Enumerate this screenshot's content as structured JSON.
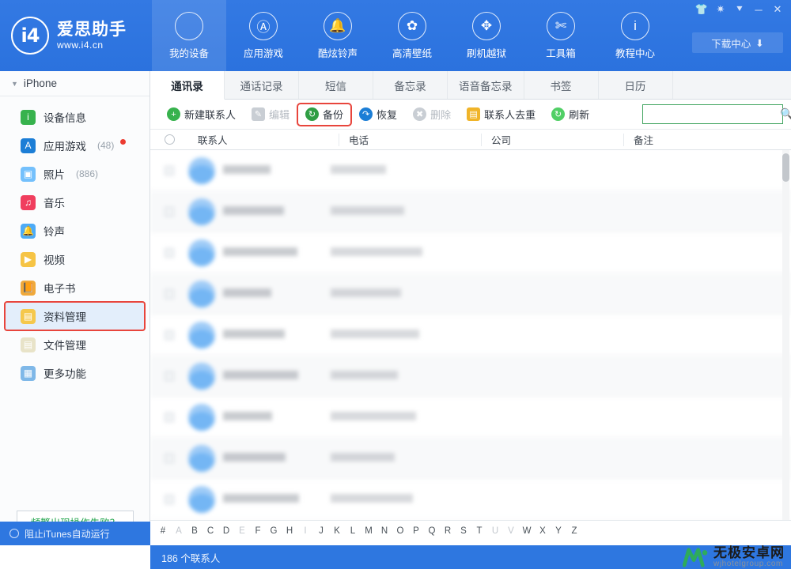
{
  "brand": {
    "logo_glyph": "i4",
    "name_cn": "爱思助手",
    "url": "www.i4.cn"
  },
  "topnav": {
    "items": [
      {
        "label": "我的设备",
        "icon": "apple-icon",
        "active": true
      },
      {
        "label": "应用游戏",
        "icon": "appstore-icon",
        "active": false
      },
      {
        "label": "酷炫铃声",
        "icon": "bell-icon",
        "active": false
      },
      {
        "label": "高清壁纸",
        "icon": "flower-icon",
        "active": false
      },
      {
        "label": "刷机越狱",
        "icon": "box-icon",
        "active": false
      },
      {
        "label": "工具箱",
        "icon": "tools-icon",
        "active": false
      },
      {
        "label": "教程中心",
        "icon": "info-icon",
        "active": false
      }
    ],
    "window_controls": [
      {
        "name": "skin-icon",
        "glyph": "👕"
      },
      {
        "name": "settings-gear-icon",
        "glyph": "✷"
      },
      {
        "name": "menu-chevron-icon",
        "glyph": "⯆"
      },
      {
        "name": "minimize-icon",
        "glyph": "─"
      },
      {
        "name": "close-icon",
        "glyph": "✕"
      }
    ],
    "download_center": {
      "label": "下载中心",
      "icon": "download-icon"
    }
  },
  "sidebar": {
    "device": {
      "label": "iPhone",
      "caret": "▼"
    },
    "items": [
      {
        "label": "设备信息",
        "count": "",
        "icon": "info-icon",
        "color": "#37b24d",
        "glyph": "i",
        "badge": false,
        "selected": false,
        "highlight": false
      },
      {
        "label": "应用游戏",
        "count": "(48)",
        "icon": "appstore-icon",
        "color": "#1c7ed6",
        "glyph": "A",
        "badge": true,
        "selected": false,
        "highlight": false
      },
      {
        "label": "照片",
        "count": "(886)",
        "icon": "photos-icon",
        "color": "#74c0fc",
        "glyph": "▣",
        "badge": false,
        "selected": false,
        "highlight": false
      },
      {
        "label": "音乐",
        "count": "",
        "icon": "music-icon",
        "color": "#f03e5e",
        "glyph": "♫",
        "badge": false,
        "selected": false,
        "highlight": false
      },
      {
        "label": "铃声",
        "count": "",
        "icon": "ringtone-bell-icon",
        "color": "#4dabf7",
        "glyph": "🔔",
        "badge": false,
        "selected": false,
        "highlight": false
      },
      {
        "label": "视频",
        "count": "",
        "icon": "video-icon",
        "color": "#f6c445",
        "glyph": "▶",
        "badge": false,
        "selected": false,
        "highlight": false
      },
      {
        "label": "电子书",
        "count": "",
        "icon": "book-icon",
        "color": "#f0a93b",
        "glyph": "📙",
        "badge": false,
        "selected": false,
        "highlight": false
      },
      {
        "label": "资料管理",
        "count": "",
        "icon": "data-manage-icon",
        "color": "#f5c84c",
        "glyph": "▤",
        "badge": false,
        "selected": true,
        "highlight": true
      },
      {
        "label": "文件管理",
        "count": "",
        "icon": "file-manage-icon",
        "color": "#e8e3c8",
        "glyph": "▤",
        "badge": false,
        "selected": false,
        "highlight": false
      },
      {
        "label": "更多功能",
        "count": "",
        "icon": "more-features-icon",
        "color": "#7fb8e8",
        "glyph": "▦",
        "badge": false,
        "selected": false,
        "highlight": false
      }
    ],
    "faq_button": "频繁出现操作失败？",
    "status": {
      "label": "阻止iTunes自动运行",
      "icon": "toggle-circle-icon"
    }
  },
  "main": {
    "tabs": [
      {
        "label": "通讯录",
        "active": true
      },
      {
        "label": "通话记录",
        "active": false
      },
      {
        "label": "短信",
        "active": false
      },
      {
        "label": "备忘录",
        "active": false
      },
      {
        "label": "语音备忘录",
        "active": false
      },
      {
        "label": "书签",
        "active": false
      },
      {
        "label": "日历",
        "active": false
      }
    ],
    "toolbar": [
      {
        "label": "新建联系人",
        "icon": "plus-circle-icon",
        "color": "#37b24d",
        "glyph": "+",
        "shape": "circle",
        "disabled": false,
        "highlight": false
      },
      {
        "label": "编辑",
        "icon": "edit-pencil-icon",
        "color": "#c9ced4",
        "glyph": "✎",
        "shape": "square",
        "disabled": true,
        "highlight": false
      },
      {
        "label": "备份",
        "icon": "backup-icon",
        "color": "#2f9e44",
        "glyph": "↻",
        "shape": "circle",
        "disabled": false,
        "highlight": true
      },
      {
        "label": "恢复",
        "icon": "restore-icon",
        "color": "#1c7ed6",
        "glyph": "↷",
        "shape": "circle",
        "disabled": false,
        "highlight": false
      },
      {
        "label": "删除",
        "icon": "delete-icon",
        "color": "#c9ced4",
        "glyph": "✖",
        "shape": "circle",
        "disabled": true,
        "highlight": false
      },
      {
        "label": "联系人去重",
        "icon": "dedupe-contacts-icon",
        "color": "#f0b429",
        "glyph": "▤",
        "shape": "square",
        "disabled": false,
        "highlight": false
      },
      {
        "label": "刷新",
        "icon": "refresh-icon",
        "color": "#51cf66",
        "glyph": "↻",
        "shape": "circle",
        "disabled": false,
        "highlight": false
      }
    ],
    "search": {
      "value": "",
      "placeholder": "",
      "icon": "search-icon"
    },
    "table": {
      "columns": [
        "联系人",
        "电话",
        "公司",
        "备注"
      ],
      "select_all_icon": "select-all-circle-icon",
      "rows": [
        {
          "name": "",
          "phone": "",
          "company": "",
          "note": ""
        },
        {
          "name": "",
          "phone": "",
          "company": "",
          "note": ""
        },
        {
          "name": "",
          "phone": "",
          "company": "",
          "note": ""
        },
        {
          "name": "",
          "phone": "",
          "company": "",
          "note": ""
        },
        {
          "name": "",
          "phone": "",
          "company": "",
          "note": ""
        },
        {
          "name": "",
          "phone": "",
          "company": "",
          "note": ""
        },
        {
          "name": "",
          "phone": "",
          "company": "",
          "note": ""
        },
        {
          "name": "",
          "phone": "",
          "company": "",
          "note": ""
        },
        {
          "name": "",
          "phone": "",
          "company": "",
          "note": ""
        }
      ]
    },
    "alpha_index": [
      {
        "ch": "#",
        "dim": false
      },
      {
        "ch": "A",
        "dim": true
      },
      {
        "ch": "B",
        "dim": false
      },
      {
        "ch": "C",
        "dim": false
      },
      {
        "ch": "D",
        "dim": false
      },
      {
        "ch": "E",
        "dim": true
      },
      {
        "ch": "F",
        "dim": false
      },
      {
        "ch": "G",
        "dim": false
      },
      {
        "ch": "H",
        "dim": false
      },
      {
        "ch": "I",
        "dim": true
      },
      {
        "ch": "J",
        "dim": false
      },
      {
        "ch": "K",
        "dim": false
      },
      {
        "ch": "L",
        "dim": false
      },
      {
        "ch": "M",
        "dim": false
      },
      {
        "ch": "N",
        "dim": false
      },
      {
        "ch": "O",
        "dim": false
      },
      {
        "ch": "P",
        "dim": false
      },
      {
        "ch": "Q",
        "dim": false
      },
      {
        "ch": "R",
        "dim": false
      },
      {
        "ch": "S",
        "dim": false
      },
      {
        "ch": "T",
        "dim": false
      },
      {
        "ch": "U",
        "dim": true
      },
      {
        "ch": "V",
        "dim": true
      },
      {
        "ch": "W",
        "dim": false
      },
      {
        "ch": "X",
        "dim": false
      },
      {
        "ch": "Y",
        "dim": false
      },
      {
        "ch": "Z",
        "dim": false
      }
    ],
    "status_text": "186 个联系人"
  },
  "watermark": {
    "cn": "无极安卓网",
    "en": "wjhotelgroup.com",
    "color": "#2eab5b"
  }
}
